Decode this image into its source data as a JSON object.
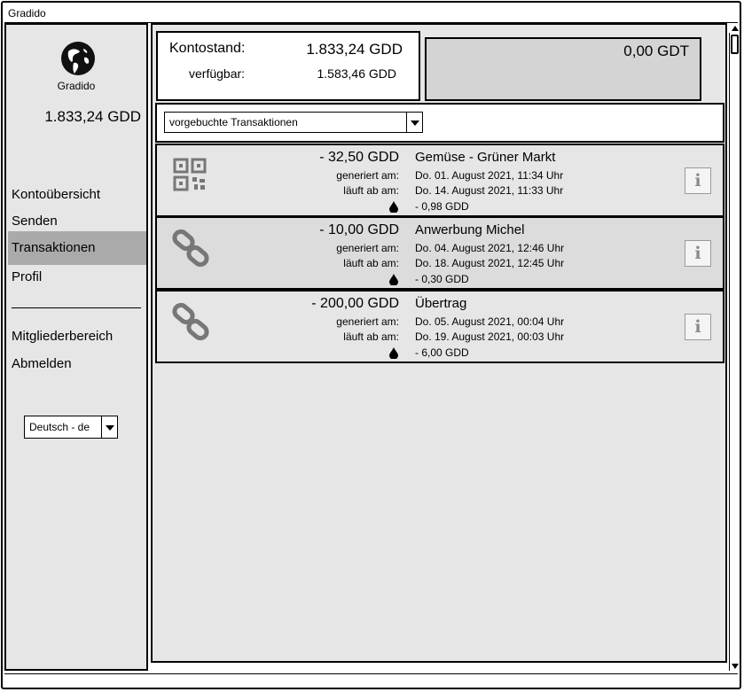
{
  "window": {
    "title": "Gradido"
  },
  "sidebar": {
    "logo_label": "Gradido",
    "balance": "1.833,24 GDD",
    "items": [
      {
        "label": "Kontoübersicht"
      },
      {
        "label": "Senden"
      },
      {
        "label": "Transaktionen",
        "active": true
      },
      {
        "label": "Profil"
      },
      {
        "label": "Mitgliederbereich"
      },
      {
        "label": "Abmelden"
      }
    ],
    "language": "Deutsch - de"
  },
  "balance": {
    "label": "Kontostand:",
    "value": "1.833,24 GDD",
    "available_label": "verfügbar:",
    "available_value": "1.583,46 GDD",
    "gdt_value": "0,00 GDT"
  },
  "filter": {
    "selected": "vorgebuchte Transaktionen"
  },
  "transactions": [
    {
      "icon": "qr-code-icon",
      "amount": "- 32,50 GDD",
      "generated_label": "generiert am:",
      "expires_label": "läuft ab am:",
      "title": "Gemüse - Grüner Markt",
      "generated": "Do. 01. August 2021, 11:34 Uhr",
      "expires": "Do. 14. August 2021, 11:33 Uhr",
      "fee": "- 0,98 GDD"
    },
    {
      "icon": "link-icon",
      "amount": "- 10,00 GDD",
      "generated_label": "generiert am:",
      "expires_label": "läuft ab am:",
      "title": "Anwerbung Michel",
      "generated": "Do. 04. August 2021, 12:46 Uhr",
      "expires": "Do. 18. August 2021, 12:45 Uhr",
      "fee": "- 0,30 GDD"
    },
    {
      "icon": "link-icon",
      "amount": "- 200,00 GDD",
      "generated_label": "generiert am:",
      "expires_label": "läuft ab am:",
      "title": "Übertrag",
      "generated": "Do. 05. August 2021, 00:04 Uhr",
      "expires": "Do. 19. August 2021, 00:03 Uhr",
      "fee": "- 6,00 GDD"
    }
  ],
  "info_glyph": "i",
  "colors": {
    "panel": "#e6e6e6",
    "active_nav": "#aaaaaa",
    "gdt_box": "#d4d4d4",
    "row_alt": "#dcdcdc"
  }
}
